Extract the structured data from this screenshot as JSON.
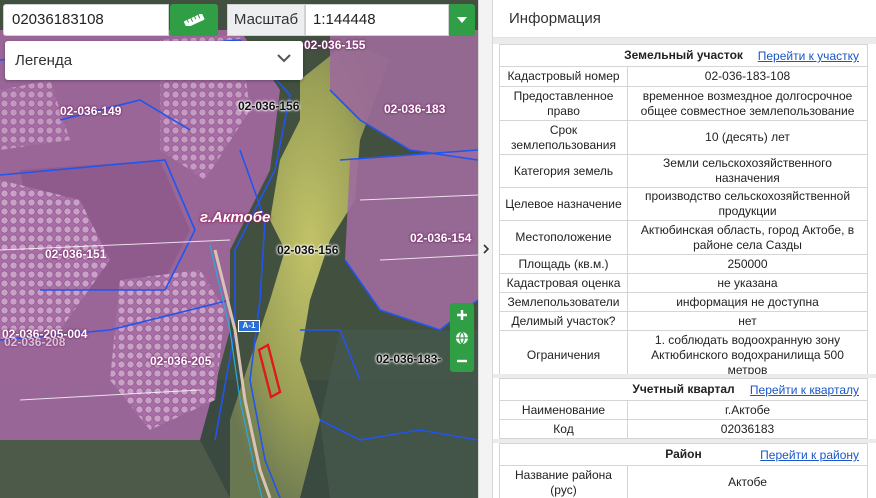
{
  "toolbar": {
    "search_value": "02036183108",
    "scale_label": "Масштаб",
    "scale_value": "1:144448",
    "legend_label": "Легенда"
  },
  "map": {
    "city_label": "г.Актобе",
    "road_shield": "A-1",
    "parcel_labels": [
      "02-036-155",
      "02-036-149",
      "02-036-156",
      "02-036-183",
      "02-036-154",
      "02-036-156",
      "02-036-151",
      "02-036-205-004",
      "02-036-208",
      "02-036-205",
      "02-036-183-"
    ]
  },
  "panel": {
    "title": "Информация",
    "land_plot": {
      "header": "Земельный участок",
      "link": "Перейти к участку",
      "rows": [
        {
          "key": "Кадастровый номер",
          "value": "02-036-183-108"
        },
        {
          "key": "Предоставленное право",
          "value": "временное возмездное долгосрочное общее совместное землепользование"
        },
        {
          "key": "Срок землепользования",
          "value": "10 (десять) лет"
        },
        {
          "key": "Категория земель",
          "value": "Земли сельскохозяйственного назначения"
        },
        {
          "key": "Целевое назначение",
          "value": "производство сельскохозяйственной продукции"
        },
        {
          "key": "Местоположение",
          "value": "Актюбинская область, город Актобе, в районе села Сазды"
        },
        {
          "key": "Площадь (кв.м.)",
          "value": "250000"
        },
        {
          "key": "Кадастровая оценка",
          "value": "не указана"
        },
        {
          "key": "Землепользователи",
          "value": "информация не доступна"
        },
        {
          "key": "Делимый участок?",
          "value": "нет"
        },
        {
          "key": "Ограничения",
          "value": "1. соблюдать водоохранную зону Актюбинского водохранилища 500 метров"
        }
      ]
    },
    "quarter": {
      "header": "Учетный квартал",
      "link": "Перейти к кварталу",
      "rows": [
        {
          "key": "Наименование",
          "value": "г.Актобе"
        },
        {
          "key": "Код",
          "value": "02036183"
        }
      ]
    },
    "district": {
      "header": "Район",
      "link": "Перейти к району",
      "rows": [
        {
          "key": "Название района (рус)",
          "value": "Актобе"
        }
      ]
    }
  },
  "colors": {
    "accent_green": "#2f9e44",
    "parcel_fill": "#b06aa8",
    "parcel_outline": "#2255ee",
    "link": "#1a56c8"
  }
}
